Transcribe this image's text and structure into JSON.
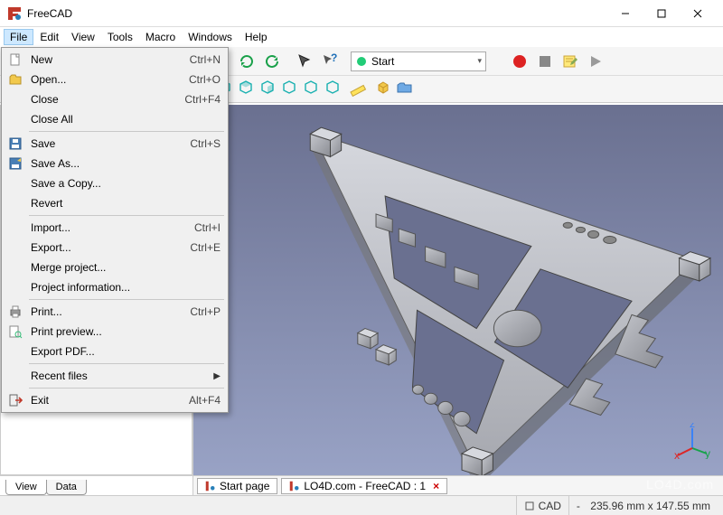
{
  "window": {
    "title": "FreeCAD"
  },
  "menubar": [
    "File",
    "Edit",
    "View",
    "Tools",
    "Macro",
    "Windows",
    "Help"
  ],
  "toolbar": {
    "workbench_combo": "Start"
  },
  "file_menu": {
    "items": [
      {
        "icon": "doc-new",
        "label": "New",
        "shortcut": "Ctrl+N"
      },
      {
        "icon": "doc-open",
        "label": "Open...",
        "shortcut": "Ctrl+O"
      },
      {
        "icon": "",
        "label": "Close",
        "shortcut": "Ctrl+F4"
      },
      {
        "icon": "",
        "label": "Close All",
        "shortcut": ""
      },
      {
        "sep": true
      },
      {
        "icon": "doc-save",
        "label": "Save",
        "shortcut": "Ctrl+S"
      },
      {
        "icon": "doc-saveas",
        "label": "Save As...",
        "shortcut": ""
      },
      {
        "icon": "",
        "label": "Save a Copy...",
        "shortcut": ""
      },
      {
        "icon": "",
        "label": "Revert",
        "shortcut": ""
      },
      {
        "sep": true
      },
      {
        "icon": "",
        "label": "Import...",
        "shortcut": "Ctrl+I"
      },
      {
        "icon": "",
        "label": "Export...",
        "shortcut": "Ctrl+E"
      },
      {
        "icon": "",
        "label": "Merge project...",
        "shortcut": ""
      },
      {
        "icon": "",
        "label": "Project information...",
        "shortcut": ""
      },
      {
        "sep": true
      },
      {
        "icon": "doc-print",
        "label": "Print...",
        "shortcut": "Ctrl+P"
      },
      {
        "icon": "doc-preview",
        "label": "Print preview...",
        "shortcut": ""
      },
      {
        "icon": "",
        "label": "Export PDF...",
        "shortcut": ""
      },
      {
        "sep": true
      },
      {
        "icon": "",
        "label": "Recent files",
        "shortcut": "",
        "submenu": true
      },
      {
        "sep": true
      },
      {
        "icon": "exit",
        "label": "Exit",
        "shortcut": "Alt+F4"
      }
    ]
  },
  "sidepanel": {
    "tabs": [
      "View",
      "Data"
    ]
  },
  "doctabs": [
    {
      "label": "Start page"
    },
    {
      "label": "LO4D.com - FreeCAD : 1",
      "closable": true
    }
  ],
  "statusbar": {
    "mode": "CAD",
    "dim_prefix": "-",
    "dimensions": "235.96 mm x 147.55 mm"
  },
  "watermark": "LO4D.com"
}
